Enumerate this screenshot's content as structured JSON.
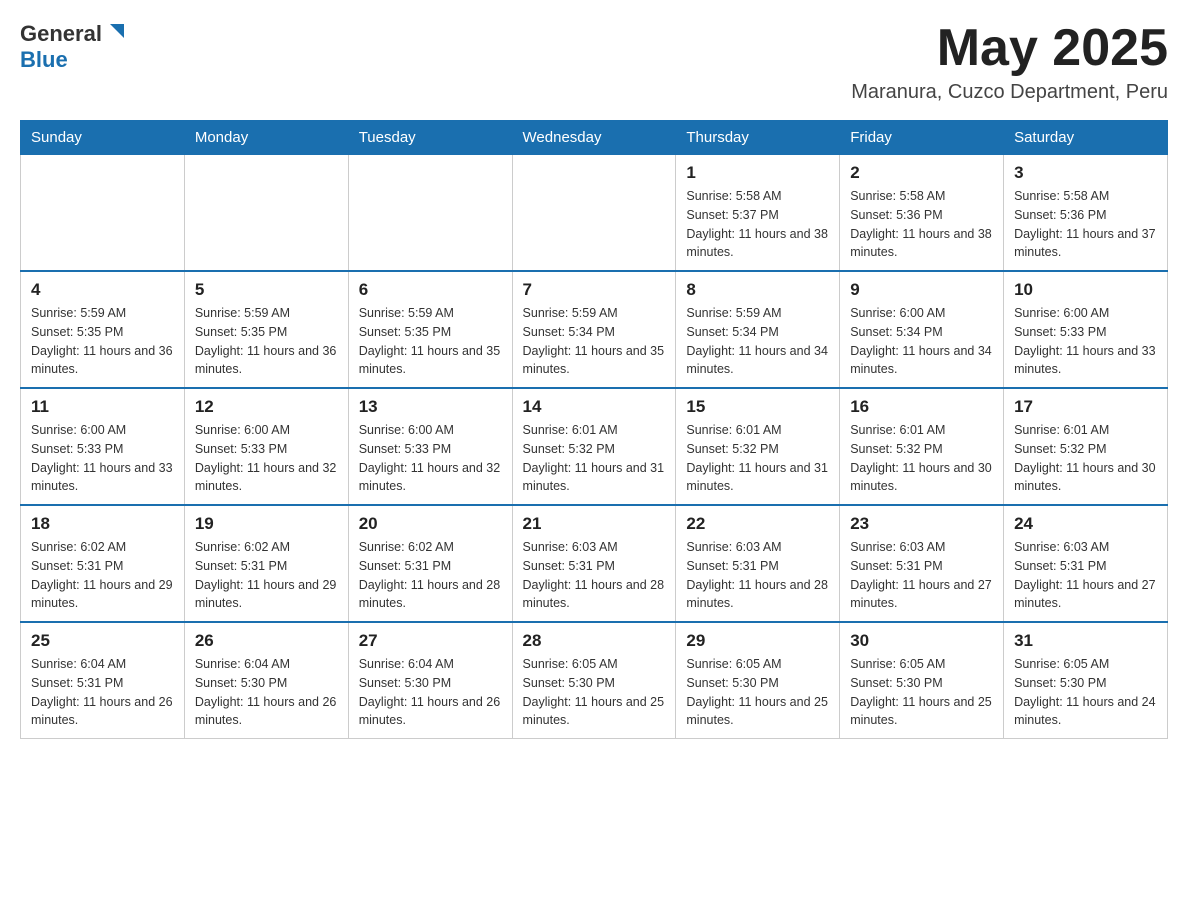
{
  "header": {
    "logo": {
      "general": "General",
      "blue": "Blue"
    },
    "title": "May 2025",
    "location": "Maranura, Cuzco Department, Peru"
  },
  "weekdays": [
    "Sunday",
    "Monday",
    "Tuesday",
    "Wednesday",
    "Thursday",
    "Friday",
    "Saturday"
  ],
  "weeks": [
    [
      {
        "day": "",
        "info": ""
      },
      {
        "day": "",
        "info": ""
      },
      {
        "day": "",
        "info": ""
      },
      {
        "day": "",
        "info": ""
      },
      {
        "day": "1",
        "info": "Sunrise: 5:58 AM\nSunset: 5:37 PM\nDaylight: 11 hours and 38 minutes."
      },
      {
        "day": "2",
        "info": "Sunrise: 5:58 AM\nSunset: 5:36 PM\nDaylight: 11 hours and 38 minutes."
      },
      {
        "day": "3",
        "info": "Sunrise: 5:58 AM\nSunset: 5:36 PM\nDaylight: 11 hours and 37 minutes."
      }
    ],
    [
      {
        "day": "4",
        "info": "Sunrise: 5:59 AM\nSunset: 5:35 PM\nDaylight: 11 hours and 36 minutes."
      },
      {
        "day": "5",
        "info": "Sunrise: 5:59 AM\nSunset: 5:35 PM\nDaylight: 11 hours and 36 minutes."
      },
      {
        "day": "6",
        "info": "Sunrise: 5:59 AM\nSunset: 5:35 PM\nDaylight: 11 hours and 35 minutes."
      },
      {
        "day": "7",
        "info": "Sunrise: 5:59 AM\nSunset: 5:34 PM\nDaylight: 11 hours and 35 minutes."
      },
      {
        "day": "8",
        "info": "Sunrise: 5:59 AM\nSunset: 5:34 PM\nDaylight: 11 hours and 34 minutes."
      },
      {
        "day": "9",
        "info": "Sunrise: 6:00 AM\nSunset: 5:34 PM\nDaylight: 11 hours and 34 minutes."
      },
      {
        "day": "10",
        "info": "Sunrise: 6:00 AM\nSunset: 5:33 PM\nDaylight: 11 hours and 33 minutes."
      }
    ],
    [
      {
        "day": "11",
        "info": "Sunrise: 6:00 AM\nSunset: 5:33 PM\nDaylight: 11 hours and 33 minutes."
      },
      {
        "day": "12",
        "info": "Sunrise: 6:00 AM\nSunset: 5:33 PM\nDaylight: 11 hours and 32 minutes."
      },
      {
        "day": "13",
        "info": "Sunrise: 6:00 AM\nSunset: 5:33 PM\nDaylight: 11 hours and 32 minutes."
      },
      {
        "day": "14",
        "info": "Sunrise: 6:01 AM\nSunset: 5:32 PM\nDaylight: 11 hours and 31 minutes."
      },
      {
        "day": "15",
        "info": "Sunrise: 6:01 AM\nSunset: 5:32 PM\nDaylight: 11 hours and 31 minutes."
      },
      {
        "day": "16",
        "info": "Sunrise: 6:01 AM\nSunset: 5:32 PM\nDaylight: 11 hours and 30 minutes."
      },
      {
        "day": "17",
        "info": "Sunrise: 6:01 AM\nSunset: 5:32 PM\nDaylight: 11 hours and 30 minutes."
      }
    ],
    [
      {
        "day": "18",
        "info": "Sunrise: 6:02 AM\nSunset: 5:31 PM\nDaylight: 11 hours and 29 minutes."
      },
      {
        "day": "19",
        "info": "Sunrise: 6:02 AM\nSunset: 5:31 PM\nDaylight: 11 hours and 29 minutes."
      },
      {
        "day": "20",
        "info": "Sunrise: 6:02 AM\nSunset: 5:31 PM\nDaylight: 11 hours and 28 minutes."
      },
      {
        "day": "21",
        "info": "Sunrise: 6:03 AM\nSunset: 5:31 PM\nDaylight: 11 hours and 28 minutes."
      },
      {
        "day": "22",
        "info": "Sunrise: 6:03 AM\nSunset: 5:31 PM\nDaylight: 11 hours and 28 minutes."
      },
      {
        "day": "23",
        "info": "Sunrise: 6:03 AM\nSunset: 5:31 PM\nDaylight: 11 hours and 27 minutes."
      },
      {
        "day": "24",
        "info": "Sunrise: 6:03 AM\nSunset: 5:31 PM\nDaylight: 11 hours and 27 minutes."
      }
    ],
    [
      {
        "day": "25",
        "info": "Sunrise: 6:04 AM\nSunset: 5:31 PM\nDaylight: 11 hours and 26 minutes."
      },
      {
        "day": "26",
        "info": "Sunrise: 6:04 AM\nSunset: 5:30 PM\nDaylight: 11 hours and 26 minutes."
      },
      {
        "day": "27",
        "info": "Sunrise: 6:04 AM\nSunset: 5:30 PM\nDaylight: 11 hours and 26 minutes."
      },
      {
        "day": "28",
        "info": "Sunrise: 6:05 AM\nSunset: 5:30 PM\nDaylight: 11 hours and 25 minutes."
      },
      {
        "day": "29",
        "info": "Sunrise: 6:05 AM\nSunset: 5:30 PM\nDaylight: 11 hours and 25 minutes."
      },
      {
        "day": "30",
        "info": "Sunrise: 6:05 AM\nSunset: 5:30 PM\nDaylight: 11 hours and 25 minutes."
      },
      {
        "day": "31",
        "info": "Sunrise: 6:05 AM\nSunset: 5:30 PM\nDaylight: 11 hours and 24 minutes."
      }
    ]
  ]
}
